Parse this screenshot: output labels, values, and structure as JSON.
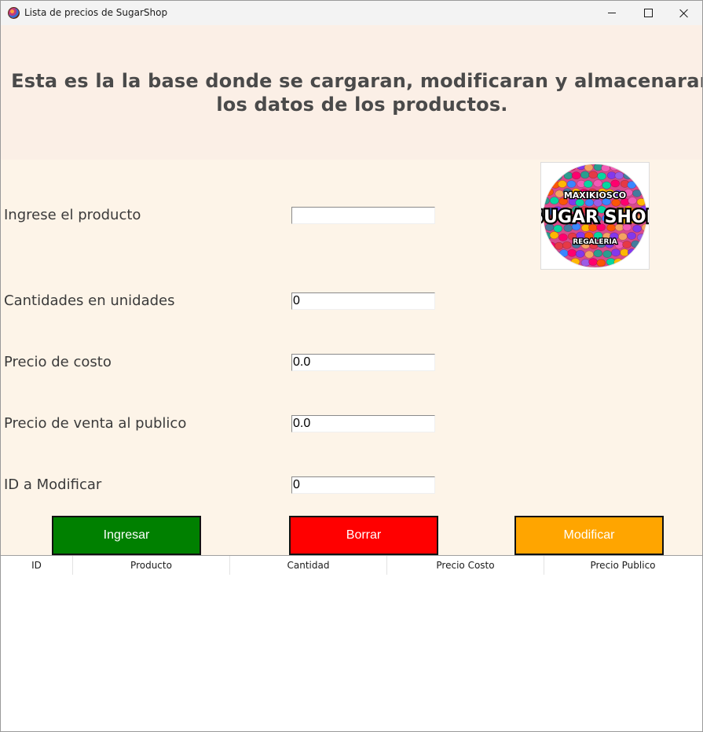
{
  "window": {
    "title": "Lista de precios de SugarShop"
  },
  "header": {
    "line1": "Esta es la la base donde se cargaran, modificaran y almacenaran",
    "line2": "los datos de los productos."
  },
  "logo": {
    "top_text": "MAXIKIOSCO",
    "main_text": "SUGAR SHOP",
    "bottom_text": "REGALERIA"
  },
  "form": {
    "producto": {
      "label": "Ingrese el producto",
      "value": ""
    },
    "cantidad": {
      "label": "Cantidades en unidades",
      "value": "0"
    },
    "costo": {
      "label": "Precio de costo",
      "value": "0.0"
    },
    "venta": {
      "label": "Precio de venta al publico",
      "value": "0.0"
    },
    "id": {
      "label": "ID a Modificar",
      "value": "0"
    }
  },
  "buttons": {
    "ingresar": "Ingresar",
    "borrar": "Borrar",
    "modificar": "Modificar"
  },
  "table": {
    "columns": [
      "ID",
      "Producto",
      "Cantidad",
      "Precio Costo",
      "Precio Publico"
    ],
    "rows": []
  },
  "colors": {
    "ingresar": "#008000",
    "borrar": "#ff0000",
    "modificar": "#ffa500",
    "form_bg": "#fdf4e8",
    "header_bg": "#fbefe6"
  }
}
